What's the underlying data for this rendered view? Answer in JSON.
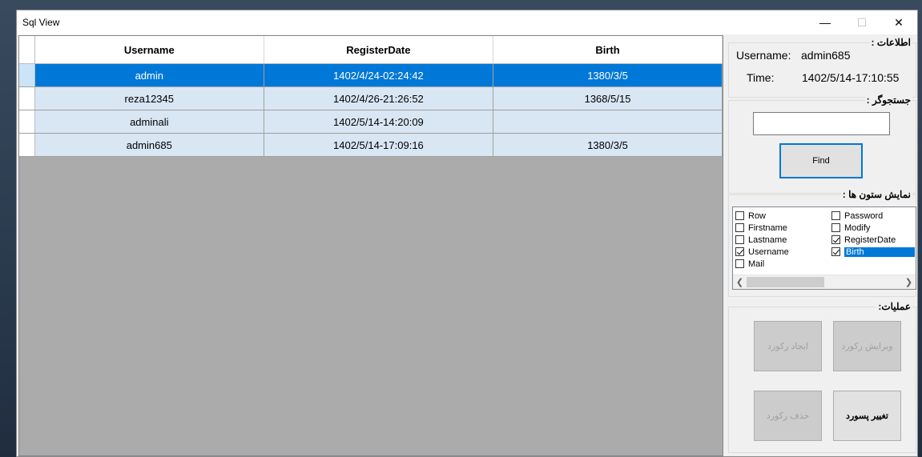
{
  "window": {
    "title": "Sql View"
  },
  "grid": {
    "columns": [
      "Username",
      "RegisterDate",
      "Birth"
    ],
    "rows": [
      {
        "username": "admin",
        "register_date": "1402/4/24-02:24:42",
        "birth": "1380/3/5",
        "selected": true
      },
      {
        "username": "reza12345",
        "register_date": "1402/4/26-21:26:52",
        "birth": "1368/5/15",
        "selected": false
      },
      {
        "username": "adminali",
        "register_date": "1402/5/14-14:20:09",
        "birth": "",
        "selected": false
      },
      {
        "username": "admin685",
        "register_date": "1402/5/14-17:09:16",
        "birth": "1380/3/5",
        "selected": false
      }
    ]
  },
  "info": {
    "label": "اطلاعات :",
    "username_label": "Username:",
    "username_value": "admin685",
    "time_label": "Time:",
    "time_value": "1402/5/14-17:10:55"
  },
  "search": {
    "label": "جستجوگر :",
    "value": "",
    "find_label": "Find"
  },
  "columns_panel": {
    "label": "نمایش ستون ها :",
    "items": [
      {
        "label": "Row",
        "checked": false
      },
      {
        "label": "Firstname",
        "checked": false
      },
      {
        "label": "Lastname",
        "checked": false
      },
      {
        "label": "Username",
        "checked": true
      },
      {
        "label": "Mail",
        "checked": false
      },
      {
        "label": "Password",
        "checked": false
      },
      {
        "label": "Modify",
        "checked": false
      },
      {
        "label": "RegisterDate",
        "checked": true
      },
      {
        "label": "Birth",
        "checked": true,
        "highlighted": true
      }
    ]
  },
  "operations": {
    "label": "عملیات:",
    "create": "ایجاد رکورد",
    "edit": "ویرایش رکورد",
    "delete": "حذف رکورد",
    "change_password": "تغییر پسورد"
  },
  "colors": {
    "selection": "#0078d7",
    "row_bg": "#d9e6f3",
    "grid_empty": "#ababab"
  }
}
